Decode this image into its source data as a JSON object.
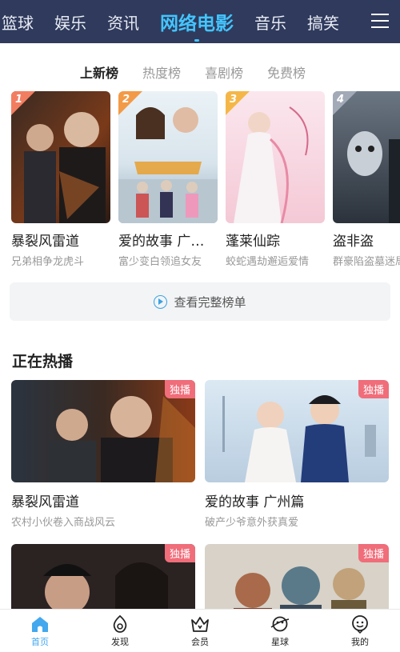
{
  "topnav": {
    "tabs": [
      "篮球",
      "娱乐",
      "资讯",
      "网络电影",
      "音乐",
      "搞笑"
    ],
    "active": "网络电影",
    "menu_icon": "menu-icon"
  },
  "ranking": {
    "tabs": [
      "上新榜",
      "热度榜",
      "喜剧榜",
      "免费榜"
    ],
    "active": "上新榜",
    "items": [
      {
        "rank": "1",
        "title": "暴裂风雷道",
        "subtitle": "兄弟相争龙虎斗"
      },
      {
        "rank": "2",
        "title": "爱的故事 广州篇",
        "subtitle": "富少变白领追女友"
      },
      {
        "rank": "3",
        "title": "蓬莱仙踪",
        "subtitle": "蛟蛇遇劫邂逅爱情"
      },
      {
        "rank": "4",
        "title": "盗非盗",
        "subtitle": "群豪陷盗墓迷局"
      }
    ],
    "view_all": "查看完整榜单"
  },
  "hot": {
    "section_title": "正在热播",
    "badge": "独播",
    "items": [
      {
        "title": "暴裂风雷道",
        "subtitle": "农村小伙卷入商战风云"
      },
      {
        "title": "爱的故事 广州篇",
        "subtitle": "破产少爷意外获真爱"
      },
      {
        "title": "",
        "subtitle": ""
      },
      {
        "title": "",
        "subtitle": ""
      }
    ]
  },
  "bottomnav": {
    "items": [
      {
        "label": "首页",
        "icon": "home-icon"
      },
      {
        "label": "发现",
        "icon": "discover-icon"
      },
      {
        "label": "会员",
        "icon": "vip-crown-icon"
      },
      {
        "label": "星球",
        "icon": "planet-icon"
      },
      {
        "label": "我的",
        "icon": "profile-icon"
      }
    ],
    "active": "首页"
  },
  "colors": {
    "topnav_bg": "#2f3a5c",
    "accent": "#43c5ff",
    "exclusive_badge": "#f06d7a"
  }
}
